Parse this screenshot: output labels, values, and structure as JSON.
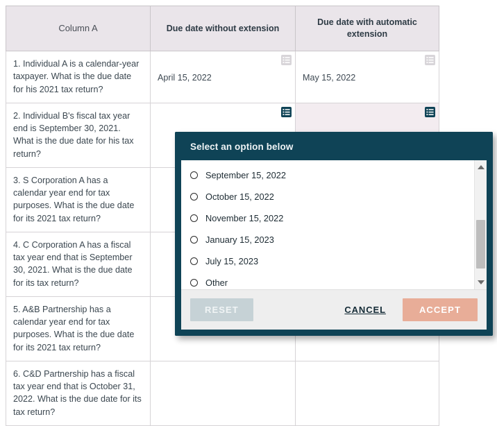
{
  "table": {
    "headers": [
      {
        "label": "Column A",
        "style": "plain"
      },
      {
        "label": "Due date without extension",
        "style": "bold"
      },
      {
        "label": "Due date with automatic extension",
        "style": "bold"
      }
    ],
    "rows": [
      {
        "question": "1. Individual A is a calendar-year taxpayer. What is the due date for his 2021 tax return?",
        "answer_without_extension": "April 15, 2022",
        "answer_with_extension": "May 15, 2022",
        "icon_state": "inactive",
        "highlight": false
      },
      {
        "question": "2. Individual B's fiscal tax year end is September 30, 2021. What is the due date for his tax return?",
        "answer_without_extension": "",
        "answer_with_extension": "",
        "icon_state": "active",
        "highlight": true
      },
      {
        "question": "3. S Corporation A has a calendar year end for tax purposes. What is the due date for its 2021 tax return?",
        "answer_without_extension": "",
        "answer_with_extension": "",
        "icon_state": "none",
        "highlight": false
      },
      {
        "question": "4. C Corporation A has a fiscal tax year end that is September 30, 2021. What is the due date for its tax return?",
        "answer_without_extension": "",
        "answer_with_extension": "",
        "icon_state": "none",
        "highlight": false
      },
      {
        "question": "5. A&B Partnership has a calendar year end for tax purposes. What is the due date for its 2021 tax return?",
        "answer_without_extension": "",
        "answer_with_extension": "",
        "icon_state": "none",
        "highlight": false
      },
      {
        "question": "6. C&D Partnership has a fiscal tax year end that is October 31, 2022. What is the due date for its tax return?",
        "answer_without_extension": "",
        "answer_with_extension": "",
        "icon_state": "none",
        "highlight": false
      }
    ],
    "cell_icon_name": "list-options-icon"
  },
  "dialog": {
    "title": "Select an option below",
    "options": [
      {
        "label": "September 15, 2022",
        "selected": false
      },
      {
        "label": "October 15, 2022",
        "selected": false
      },
      {
        "label": "November 15, 2022",
        "selected": false
      },
      {
        "label": "January 15, 2023",
        "selected": false
      },
      {
        "label": "July 15, 2023",
        "selected": false
      },
      {
        "label": "Other",
        "selected": false
      }
    ],
    "buttons": {
      "reset": "RESET",
      "cancel": "CANCEL",
      "accept": "ACCEPT"
    }
  },
  "colors": {
    "dialog_frame": "#0f4356",
    "header_bg": "#eae5ea",
    "highlight_row": "#f3ecf0",
    "accept_button": "#e8ad98",
    "reset_button": "#c6d2d6",
    "icon_active": "#0f4356",
    "icon_inactive": "#d8d5d9"
  }
}
